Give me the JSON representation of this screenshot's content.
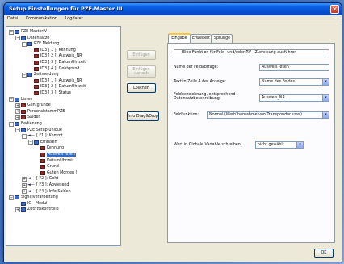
{
  "window": {
    "title": "Setup Einstellungen für PZE-Master III",
    "close_glyph": "✕"
  },
  "menu": [
    "Datei",
    "Kommunikation",
    "Logdater"
  ],
  "tree": [
    {
      "label": "PZE-MasterIV",
      "icon": "grid",
      "expander": "−"
    },
    {
      "label": "Datensätze",
      "icon": "grid",
      "expander": "−"
    },
    {
      "label": "PZE Meldung",
      "icon": "grid",
      "expander": "−"
    },
    {
      "label": "ID3 [ 1 ]: Kennung",
      "icon": "field",
      "expander": ""
    },
    {
      "label": "ID3 [ 2 ]: Ausweis_NR",
      "icon": "field",
      "expander": ""
    },
    {
      "label": "ID3 [ 3 ]: DatumUhrzeit",
      "icon": "field",
      "expander": ""
    },
    {
      "label": "ID3 [ 4 ]: Gehtgrund",
      "icon": "field",
      "expander": ""
    },
    {
      "label": "Zeitmeldung",
      "icon": "grid",
      "expander": "−"
    },
    {
      "label": "ID3 [ 1 ]: Ausweis_NR",
      "icon": "field",
      "expander": ""
    },
    {
      "label": "ID3 [ 2 ]: DatumUhrzeit",
      "icon": "field",
      "expander": ""
    },
    {
      "label": "ID3 [ 3 ]: Status",
      "icon": "field",
      "expander": ""
    },
    {
      "label": "Listen",
      "icon": "grid",
      "expander": "−"
    },
    {
      "label": "Gehtgründe",
      "icon": "field",
      "expander": "+"
    },
    {
      "label": "PersonalstammPZE",
      "icon": "field",
      "expander": "+"
    },
    {
      "label": "Salden",
      "icon": "field",
      "expander": "+"
    },
    {
      "label": "Bedienung",
      "icon": "grid",
      "expander": "−"
    },
    {
      "label": "PZE Setup-unique",
      "icon": "grid",
      "expander": "−"
    },
    {
      "label": "[ F1 ]: Kommt",
      "icon": "arrow",
      "expander": "−"
    },
    {
      "label": "Erfassen",
      "icon": "grid",
      "expander": "−"
    },
    {
      "label": "Kennung",
      "icon": "field",
      "expander": ""
    },
    {
      "label": "Ausweis lesen",
      "icon": "field",
      "expander": "",
      "selected": true
    },
    {
      "label": "DatumUhrzeit",
      "icon": "field",
      "expander": ""
    },
    {
      "label": "Grund",
      "icon": "field",
      "expander": ""
    },
    {
      "label": "Guten Morgen !",
      "icon": "field",
      "expander": ""
    },
    {
      "label": "[ F2 ]: Geht",
      "icon": "arrow",
      "expander": "+"
    },
    {
      "label": "[ F3 ]: Abwesend",
      "icon": "arrow",
      "expander": "+"
    },
    {
      "label": "[ F4 ]: Info Salden",
      "icon": "arrow",
      "expander": "+"
    },
    {
      "label": "Signalverarbeitung",
      "icon": "grid",
      "expander": "−"
    },
    {
      "label": "IO - Modul",
      "icon": "grid",
      "expander": ""
    },
    {
      "label": "Zutrittskontrolle",
      "icon": "grid",
      "expander": "+"
    }
  ],
  "buttons": {
    "einfuegen": "Einfügen",
    "einfuegen_danach": "Einfügen danach",
    "loeschen": "Löschen",
    "info_dragdrop": "Info Drag&Drop",
    "ok": "OK"
  },
  "tabs": [
    "Eingabe",
    "Erweitert",
    "Sprünge"
  ],
  "panel": {
    "hint": "Eine Funktion für Feld- und/oder RV - Zuweisung ausführen",
    "fields": {
      "name_label": "Name der Feldabfrage:",
      "name_value": "Ausweis lesen",
      "text_label": "Text in Zeile 4 der Anzeige:",
      "text_value": "Name des Feldes",
      "feld_label": "Feldbezeichnung, entsprechend Datensatzbeschreibung:",
      "feld_value": "Ausweis_NR",
      "funktion_label": "Feldfunktion:",
      "funktion_value": "Normal (Wertübernahme von Transponder usw.)",
      "wert_label": "Wert in Globale Variable schreiben:",
      "wert_value": "nicht gewählt"
    }
  },
  "icons": {
    "dropdown": "▾",
    "arrow": "◄—"
  }
}
